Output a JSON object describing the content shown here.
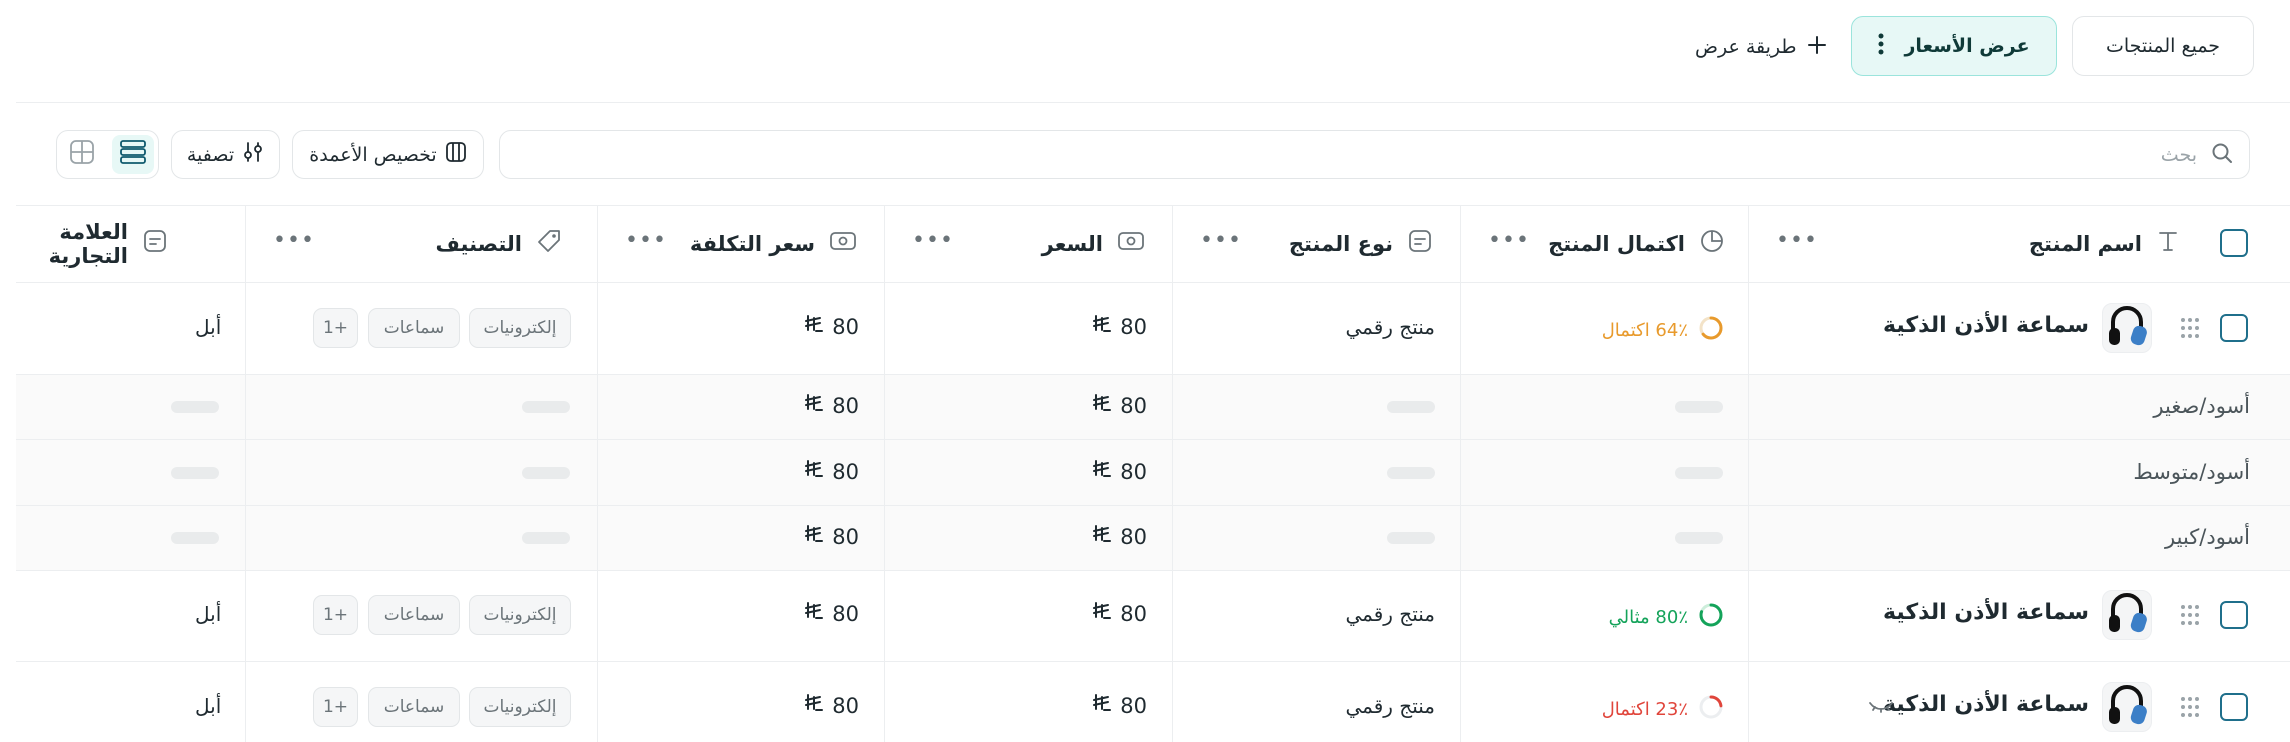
{
  "views": {
    "all_products": "جميع المنتجات",
    "prices_view": "عرض الأسعار",
    "add_view": "طريقة عرض"
  },
  "toolbar": {
    "search_placeholder": "بحث",
    "customize_columns": "تخصيص الأعمدة",
    "filter": "تصفية"
  },
  "columns": {
    "name": "اسم المنتج",
    "completion": "اكتمال المنتج",
    "type": "نوع المنتج",
    "price": "السعر",
    "cost": "سعر التكلفة",
    "category": "التصنيف",
    "brand": "العلامة التجارية"
  },
  "colors": {
    "accent": "#1f6f8b",
    "orange": "#e89a2c",
    "green": "#14a35a",
    "red": "#e0453b"
  },
  "rows": [
    {
      "name": "سماعة الأذن الذكية",
      "completion": "64٪ اكتمال",
      "completion_value": 0.64,
      "type": "منتج رقمي",
      "price": "80",
      "cost": "80",
      "tags": [
        "إلكترونيات",
        "سماعات"
      ],
      "more": "+1",
      "brand": "أبل"
    },
    {
      "name": "سماعة الأذن الذكية",
      "completion": "80٪ مثالي",
      "completion_value": 0.8,
      "type": "منتج رقمي",
      "price": "80",
      "cost": "80",
      "tags": [
        "إلكترونيات",
        "سماعات"
      ],
      "more": "+1",
      "brand": "أبل"
    },
    {
      "name": "سماعة الأذن الذكية",
      "completion": "23٪ اكتمال",
      "completion_value": 0.23,
      "type": "منتج رقمي",
      "price": "80",
      "cost": "80",
      "tags": [
        "إلكترونيات",
        "سماعات"
      ],
      "more": "+1",
      "brand": "أبل"
    }
  ],
  "variants": [
    {
      "name": "أسود/صغير",
      "price": "80",
      "cost": "80"
    },
    {
      "name": "أسود/متوسط",
      "price": "80",
      "cost": "80"
    },
    {
      "name": "أسود/كبير",
      "price": "80",
      "cost": "80"
    }
  ]
}
